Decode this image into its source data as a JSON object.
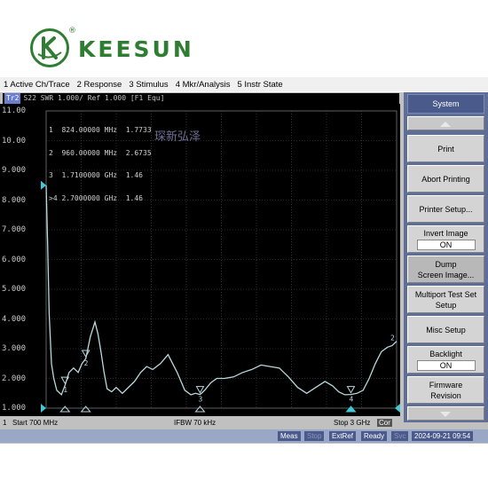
{
  "logo": {
    "brand": "KEESUN",
    "reg": "®"
  },
  "menu": [
    "1 Active Ch/Trace",
    "2 Response",
    "3 Stimulus",
    "4 Mkr/Analysis",
    "5 Instr State"
  ],
  "trace_header": {
    "badge": "Tr2",
    "text": "S22  SWR 1.000/ Ref 1.000 [F1 Equ]"
  },
  "markers": [
    {
      "num": "1",
      "freq": "824.00000 MHz",
      "value": "1.7733"
    },
    {
      "num": "2",
      "freq": "960.00000 MHz",
      "value": "2.6735"
    },
    {
      "num": "3",
      "freq": "1.7100000 GHz",
      "value": "1.46"
    },
    {
      "num": ">4",
      "freq": "2.7000000 GHz",
      "value": "1.46"
    }
  ],
  "watermark": "琛新弘泽",
  "y_labels": [
    "11.00",
    "10.00",
    "9.000",
    "8.000",
    "7.000",
    "6.000",
    "5.000",
    "4.000",
    "3.000",
    "2.000",
    "1.000"
  ],
  "chart_data": {
    "type": "line",
    "xlabel": "",
    "ylabel": "",
    "ylim": [
      1,
      11
    ],
    "x_unit": "MHz",
    "xlim": [
      700,
      3000
    ],
    "series": [
      {
        "x": [
          700,
          710,
          720,
          735,
          750,
          770,
          800,
          824,
          850,
          880,
          910,
          935,
          960,
          990,
          1020,
          1040,
          1060,
          1080,
          1100,
          1130,
          1160,
          1200,
          1240,
          1280,
          1320,
          1360,
          1400,
          1450,
          1500,
          1560,
          1610,
          1650,
          1680,
          1710,
          1740,
          1780,
          1820,
          1870,
          1930,
          1990,
          2050,
          2110,
          2170,
          2230,
          2290,
          2350,
          2410,
          2470,
          2530,
          2580,
          2620,
          2660,
          2700,
          2740,
          2780,
          2820,
          2860,
          2900,
          2940,
          2970,
          3000
        ],
        "y": [
          8.5,
          6.5,
          4.2,
          2.5,
          2.0,
          1.6,
          1.45,
          1.77,
          2.2,
          2.35,
          2.2,
          2.5,
          2.67,
          3.4,
          3.9,
          3.5,
          2.9,
          2.2,
          1.65,
          1.55,
          1.7,
          1.5,
          1.7,
          1.9,
          2.2,
          2.4,
          2.3,
          2.5,
          2.8,
          2.2,
          1.6,
          1.45,
          1.5,
          1.46,
          1.6,
          1.85,
          2.0,
          2.0,
          2.05,
          2.2,
          2.3,
          2.45,
          2.4,
          2.35,
          2.05,
          1.7,
          1.5,
          1.7,
          1.9,
          1.75,
          1.55,
          1.45,
          1.46,
          1.5,
          1.6,
          2.0,
          2.5,
          2.9,
          3.05,
          3.1,
          3.25
        ]
      }
    ],
    "marker_points": [
      {
        "label": "1",
        "x": 824,
        "y": 1.7733
      },
      {
        "label": "2",
        "x": 960,
        "y": 2.6735
      },
      {
        "label": "3",
        "x": 1710,
        "y": 1.46
      },
      {
        "label": "4",
        "x": 2700,
        "y": 1.46
      }
    ],
    "end_label": "2"
  },
  "status": {
    "ch": "1",
    "start": "Start 700 MHz",
    "ifbw": "IFBW 70 kHz",
    "stop": "Stop 3 GHz",
    "cor": "Cor"
  },
  "bottom": {
    "meas": "Meas",
    "stop": "Stop",
    "extref": "ExtRef",
    "ready": "Ready",
    "svc": "Svc",
    "datetime": "2024-09-21 09:54"
  },
  "softkeys": {
    "header": "System",
    "print": "Print",
    "abort": "Abort Printing",
    "printer_setup": "Printer Setup...",
    "invert_image": "Invert Image",
    "invert_value": "ON",
    "dump_line1": "Dump",
    "dump_line2": "Screen Image...",
    "multiport_line1": "Multiport Test Set",
    "multiport_line2": "Setup",
    "misc": "Misc Setup",
    "backlight": "Backlight",
    "backlight_value": "ON",
    "firmware_line1": "Firmware",
    "firmware_line2": "Revision"
  }
}
